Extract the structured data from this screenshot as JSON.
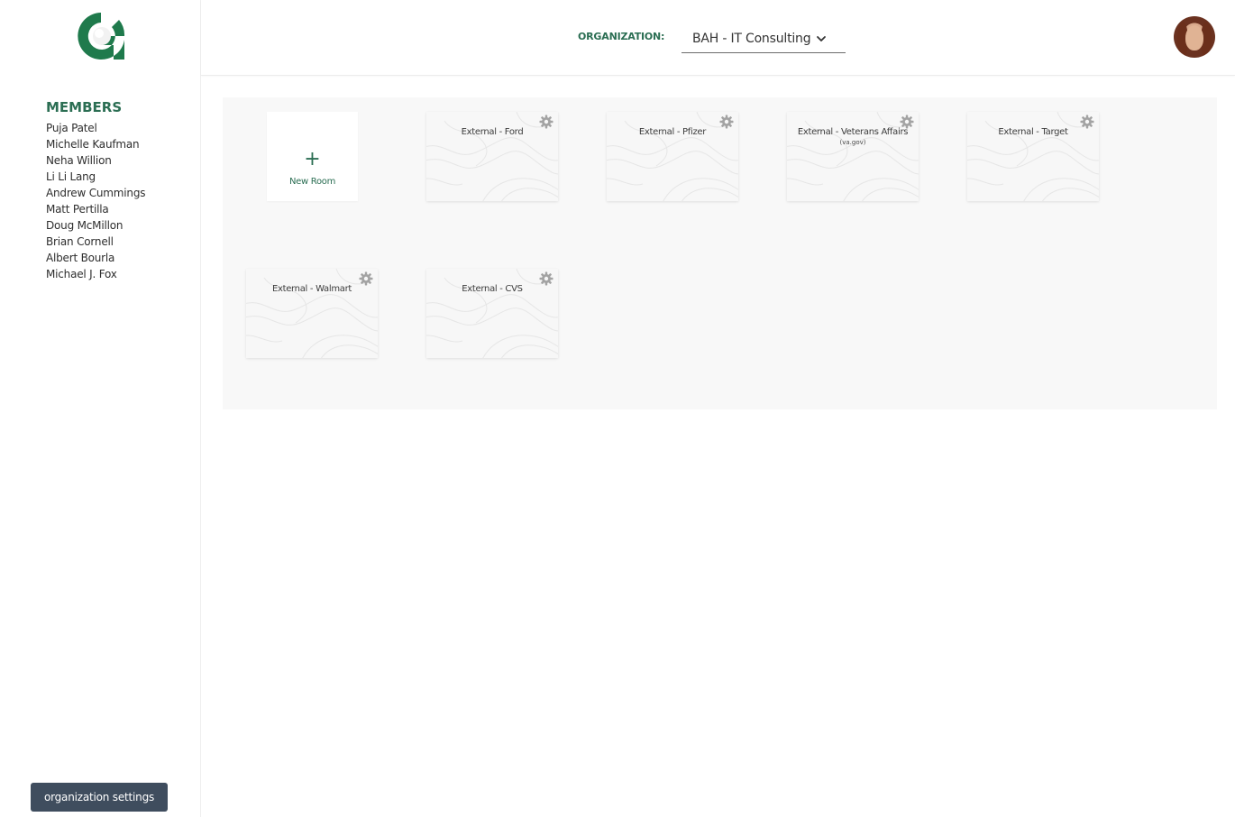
{
  "sidebar": {
    "members_title": "MEMBERS",
    "members": [
      "Puja Patel",
      "Michelle Kaufman",
      "Neha Willion",
      "Li Li Lang",
      "Andrew Cummings",
      "Matt Pertilla",
      "Doug McMillon",
      "Brian Cornell",
      "Albert Bourla",
      "Michael J. Fox"
    ],
    "org_settings_label": "organization settings"
  },
  "header": {
    "org_label": "ORGANIZATION:",
    "org_value": "BAH - IT Consulting"
  },
  "rooms": {
    "new_room": {
      "icon": "+",
      "label": "New Room"
    },
    "items": [
      {
        "name": "External - Ford",
        "subtitle": ""
      },
      {
        "name": "External - Pfizer",
        "subtitle": ""
      },
      {
        "name": "External - Veterans Affairs",
        "subtitle": "(va.gov)"
      },
      {
        "name": "External - Target",
        "subtitle": ""
      },
      {
        "name": "External - Walmart",
        "subtitle": ""
      },
      {
        "name": "External - CVS",
        "subtitle": ""
      }
    ]
  },
  "colors": {
    "brand_green": "#2b6e53",
    "button_dark": "#3f4d5e",
    "card_bg": "#f7f7f7",
    "area_bg": "#f8f8f8"
  },
  "icons": {
    "logo": "g-logo-icon",
    "chevron": "chevron-down-icon",
    "gear": "gear-icon",
    "plus": "plus-icon"
  }
}
